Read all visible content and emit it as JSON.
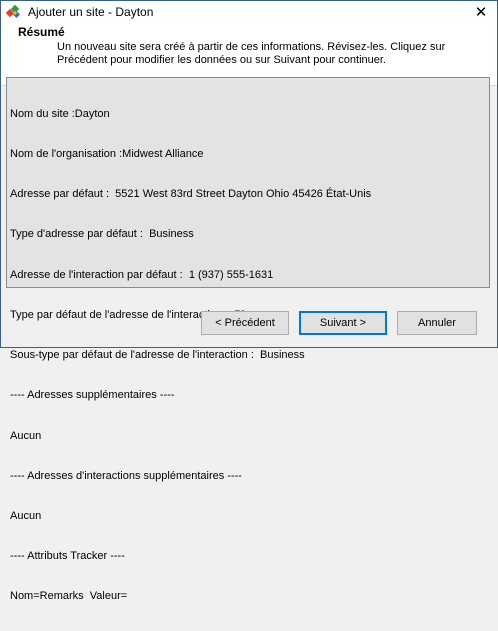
{
  "window": {
    "title": "Ajouter un site - Dayton",
    "close_glyph": "✕"
  },
  "header": {
    "title": "Résumé",
    "description": "Un nouveau site sera créé à partir de ces informations. Révisez-les. Cliquez sur Précédent pour modifier les données ou sur Suivant pour continuer."
  },
  "summary": {
    "lines": [
      "Nom du site :Dayton",
      "Nom de l'organisation :Midwest Alliance",
      "Adresse par défaut :  5521 West 83rd Street Dayton Ohio 45426 État-Unis",
      "Type d'adresse par défaut :  Business",
      "Adresse de l'interaction par défaut :  1 (937) 555-1631",
      "Type par défaut de l'adresse de l'interaction :  Phone",
      "Sous-type par défaut de l'adresse de l'interaction :  Business",
      "---- Adresses supplémentaires ----",
      "Aucun",
      "---- Adresses d'interactions supplémentaires ----",
      "Aucun",
      "---- Attributs Tracker ----",
      "Nom=Remarks  Valeur="
    ]
  },
  "buttons": {
    "previous": "< Précédent",
    "next": "Suivant >",
    "cancel": "Annuler"
  }
}
